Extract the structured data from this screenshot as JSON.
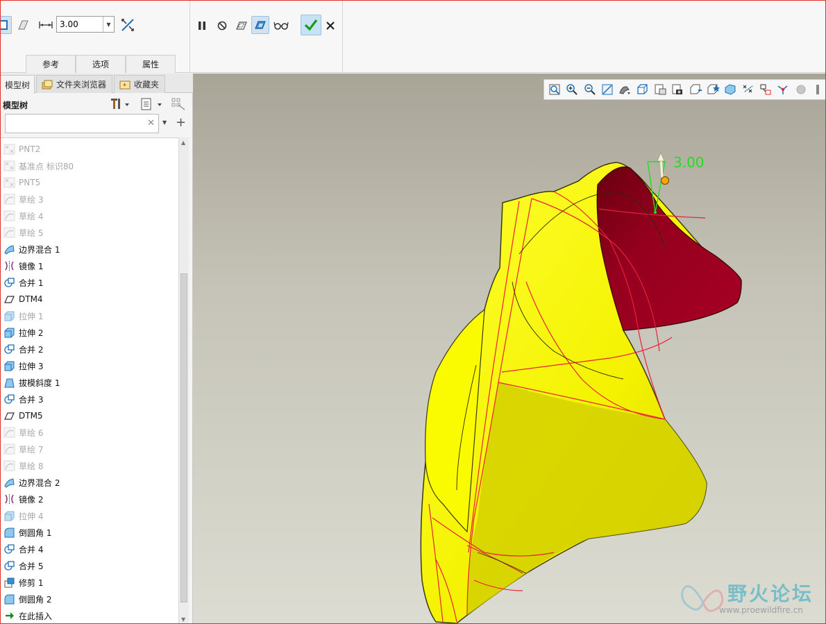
{
  "ribbon": {
    "thickness_value": "3.00",
    "tabs": [
      "参考",
      "选项",
      "属性"
    ]
  },
  "navigator": {
    "tabs": [
      "模型树",
      "文件夹浏览器",
      "收藏夹"
    ],
    "tree_title": "模型树",
    "filter_placeholder": "",
    "items": [
      {
        "label": "PNT2",
        "icon": "datum-point-icon",
        "suppressed": true
      },
      {
        "label": "基准点 标识80",
        "icon": "datum-point-icon",
        "suppressed": true
      },
      {
        "label": "PNT5",
        "icon": "datum-point-icon",
        "suppressed": true
      },
      {
        "label": "草绘 3",
        "icon": "sketch-icon",
        "suppressed": true
      },
      {
        "label": "草绘 4",
        "icon": "sketch-icon",
        "suppressed": true
      },
      {
        "label": "草绘 5",
        "icon": "sketch-icon",
        "suppressed": true
      },
      {
        "label": "边界混合 1",
        "icon": "boundary-blend-icon",
        "suppressed": false
      },
      {
        "label": "镜像 1",
        "icon": "mirror-icon",
        "suppressed": false
      },
      {
        "label": "合并 1",
        "icon": "merge-icon",
        "suppressed": false
      },
      {
        "label": "DTM4",
        "icon": "datum-plane-icon",
        "suppressed": false
      },
      {
        "label": "拉伸 1",
        "icon": "extrude-icon",
        "suppressed": true
      },
      {
        "label": "拉伸 2",
        "icon": "extrude-icon",
        "suppressed": false
      },
      {
        "label": "合并 2",
        "icon": "merge-icon",
        "suppressed": false
      },
      {
        "label": "拉伸 3",
        "icon": "extrude-icon",
        "suppressed": false
      },
      {
        "label": "拔模斜度 1",
        "icon": "draft-icon",
        "suppressed": false
      },
      {
        "label": "合并 3",
        "icon": "merge-icon",
        "suppressed": false
      },
      {
        "label": "DTM5",
        "icon": "datum-plane-icon",
        "suppressed": false
      },
      {
        "label": "草绘 6",
        "icon": "sketch-icon",
        "suppressed": true
      },
      {
        "label": "草绘 7",
        "icon": "sketch-icon",
        "suppressed": true
      },
      {
        "label": "草绘 8",
        "icon": "sketch-icon",
        "suppressed": true
      },
      {
        "label": "边界混合 2",
        "icon": "boundary-blend-icon",
        "suppressed": false
      },
      {
        "label": "镜像 2",
        "icon": "mirror-icon",
        "suppressed": false
      },
      {
        "label": "拉伸 4",
        "icon": "extrude-icon",
        "suppressed": true
      },
      {
        "label": "倒圆角 1",
        "icon": "round-icon",
        "suppressed": false
      },
      {
        "label": "合并 4",
        "icon": "merge-icon",
        "suppressed": false
      },
      {
        "label": "合并 5",
        "icon": "merge-icon",
        "suppressed": false
      },
      {
        "label": "修剪 1",
        "icon": "trim-icon",
        "suppressed": false
      },
      {
        "label": "倒圆角 2",
        "icon": "round-icon",
        "suppressed": false
      },
      {
        "label": "在此插入",
        "icon": "insert-here-arrow-icon",
        "suppressed": false
      }
    ]
  },
  "graphics": {
    "dimension_label": "3.00",
    "watermark_cn": "野火论坛",
    "watermark_url": "www.proewildfire.cn"
  },
  "colors": {
    "surface_yellow": "#f2f200",
    "surface_shadow": "#d3d000",
    "inner_crimson": "#9a0020",
    "edge_red": "#e8203a",
    "dimension_green": "#22dd22",
    "accept_green": "#1a9a1a"
  }
}
